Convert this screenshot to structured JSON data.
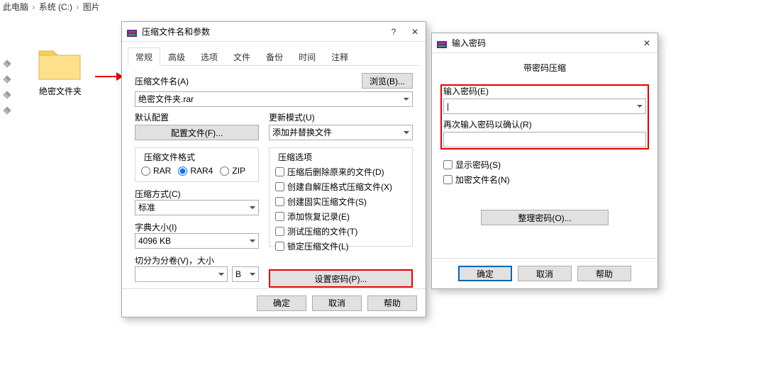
{
  "breadcrumb": {
    "a": "此电脑",
    "b": "系统 (C:)",
    "c": "图片"
  },
  "folder": {
    "name": "绝密文件夹"
  },
  "dlg1": {
    "title": "压缩文件名和参数",
    "tabs": [
      "常规",
      "高级",
      "选项",
      "文件",
      "备份",
      "时间",
      "注释"
    ],
    "browse": "浏览(B)...",
    "filenameLabel": "压缩文件名(A)",
    "filenameValue": "绝密文件夹.rar",
    "defaultProfileLabel": "默认配置",
    "profileBtn": "配置文件(F)...",
    "updateModeLabel": "更新模式(U)",
    "updateModeValue": "添加并替换文件",
    "formatGroup": "压缩文件格式",
    "formatOpts": [
      "RAR",
      "RAR4",
      "ZIP"
    ],
    "optionsGroup": "压缩选项",
    "optionsChecks": [
      "压缩后删除原来的文件(D)",
      "创建自解压格式压缩文件(X)",
      "创建固实压缩文件(S)",
      "添加恢复记录(E)",
      "测试压缩的文件(T)",
      "锁定压缩文件(L)"
    ],
    "methodLabel": "压缩方式(C)",
    "methodValue": "标准",
    "dictLabel": "字典大小(I)",
    "dictValue": "4096 KB",
    "splitLabel": "切分为分卷(V)，大小",
    "splitUnit": "B",
    "setPwd": "设置密码(P)...",
    "ok": "确定",
    "cancel": "取消",
    "help": "帮助"
  },
  "dlg2": {
    "title": "输入密码",
    "header": "带密码压缩",
    "pwdLabel": "输入密码(E)",
    "pwd2Label": "再次输入密码以确认(R)",
    "showPwd": "显示密码(S)",
    "encryptNames": "加密文件名(N)",
    "organize": "整理密码(O)...",
    "ok": "确定",
    "cancel": "取消",
    "help": "帮助"
  }
}
